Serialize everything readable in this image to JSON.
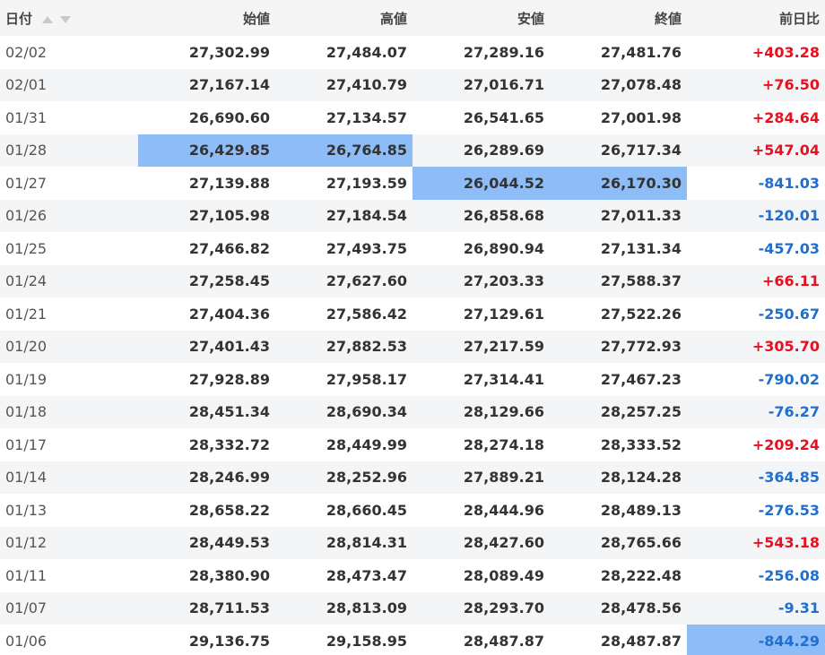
{
  "table": {
    "headers": {
      "date": "日付",
      "open": "始値",
      "high": "高値",
      "low": "安値",
      "close": "終値",
      "change": "前日比"
    },
    "colors": {
      "up": "#e8101e",
      "down": "#1f6fd1",
      "highlight": "#8ebcf7"
    },
    "rows": [
      {
        "date": "02/02",
        "open": "27,302.99",
        "high": "27,484.07",
        "low": "27,289.16",
        "close": "27,481.76",
        "change": "+403.28",
        "dir": "up",
        "hl": []
      },
      {
        "date": "02/01",
        "open": "27,167.14",
        "high": "27,410.79",
        "low": "27,016.71",
        "close": "27,078.48",
        "change": "+76.50",
        "dir": "up",
        "hl": []
      },
      {
        "date": "01/31",
        "open": "26,690.60",
        "high": "27,134.57",
        "low": "26,541.65",
        "close": "27,001.98",
        "change": "+284.64",
        "dir": "up",
        "hl": []
      },
      {
        "date": "01/28",
        "open": "26,429.85",
        "high": "26,764.85",
        "low": "26,289.69",
        "close": "26,717.34",
        "change": "+547.04",
        "dir": "up",
        "hl": [
          "open",
          "high"
        ]
      },
      {
        "date": "01/27",
        "open": "27,139.88",
        "high": "27,193.59",
        "low": "26,044.52",
        "close": "26,170.30",
        "change": "-841.03",
        "dir": "down",
        "hl": [
          "low",
          "close"
        ]
      },
      {
        "date": "01/26",
        "open": "27,105.98",
        "high": "27,184.54",
        "low": "26,858.68",
        "close": "27,011.33",
        "change": "-120.01",
        "dir": "down",
        "hl": []
      },
      {
        "date": "01/25",
        "open": "27,466.82",
        "high": "27,493.75",
        "low": "26,890.94",
        "close": "27,131.34",
        "change": "-457.03",
        "dir": "down",
        "hl": []
      },
      {
        "date": "01/24",
        "open": "27,258.45",
        "high": "27,627.60",
        "low": "27,203.33",
        "close": "27,588.37",
        "change": "+66.11",
        "dir": "up",
        "hl": []
      },
      {
        "date": "01/21",
        "open": "27,404.36",
        "high": "27,586.42",
        "low": "27,129.61",
        "close": "27,522.26",
        "change": "-250.67",
        "dir": "down",
        "hl": []
      },
      {
        "date": "01/20",
        "open": "27,401.43",
        "high": "27,882.53",
        "low": "27,217.59",
        "close": "27,772.93",
        "change": "+305.70",
        "dir": "up",
        "hl": []
      },
      {
        "date": "01/19",
        "open": "27,928.89",
        "high": "27,958.17",
        "low": "27,314.41",
        "close": "27,467.23",
        "change": "-790.02",
        "dir": "down",
        "hl": []
      },
      {
        "date": "01/18",
        "open": "28,451.34",
        "high": "28,690.34",
        "low": "28,129.66",
        "close": "28,257.25",
        "change": "-76.27",
        "dir": "down",
        "hl": []
      },
      {
        "date": "01/17",
        "open": "28,332.72",
        "high": "28,449.99",
        "low": "28,274.18",
        "close": "28,333.52",
        "change": "+209.24",
        "dir": "up",
        "hl": []
      },
      {
        "date": "01/14",
        "open": "28,246.99",
        "high": "28,252.96",
        "low": "27,889.21",
        "close": "28,124.28",
        "change": "-364.85",
        "dir": "down",
        "hl": []
      },
      {
        "date": "01/13",
        "open": "28,658.22",
        "high": "28,660.45",
        "low": "28,444.96",
        "close": "28,489.13",
        "change": "-276.53",
        "dir": "down",
        "hl": []
      },
      {
        "date": "01/12",
        "open": "28,449.53",
        "high": "28,814.31",
        "low": "28,427.60",
        "close": "28,765.66",
        "change": "+543.18",
        "dir": "up",
        "hl": []
      },
      {
        "date": "01/11",
        "open": "28,380.90",
        "high": "28,473.47",
        "low": "28,089.49",
        "close": "28,222.48",
        "change": "-256.08",
        "dir": "down",
        "hl": []
      },
      {
        "date": "01/07",
        "open": "28,711.53",
        "high": "28,813.09",
        "low": "28,293.70",
        "close": "28,478.56",
        "change": "-9.31",
        "dir": "down",
        "hl": []
      },
      {
        "date": "01/06",
        "open": "29,136.75",
        "high": "29,158.95",
        "low": "28,487.87",
        "close": "28,487.87",
        "change": "-844.29",
        "dir": "down",
        "hl": [
          "change"
        ]
      }
    ]
  }
}
